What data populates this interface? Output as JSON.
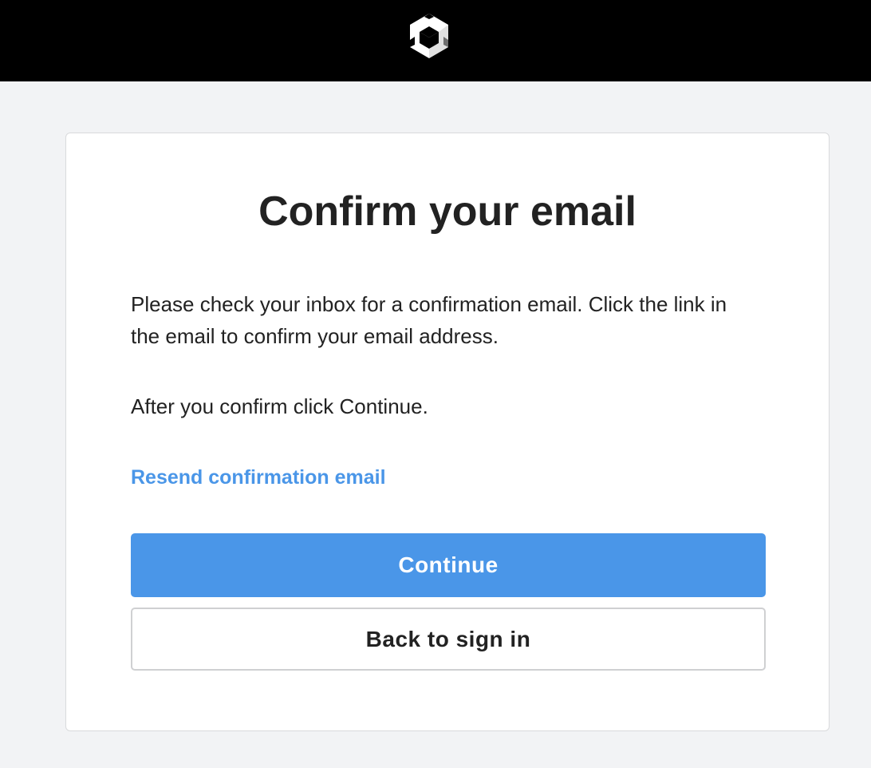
{
  "header": {
    "logo_icon": "unity-logo-icon"
  },
  "card": {
    "title": "Confirm your email",
    "message_1": "Please check your inbox for a confirmation email. Click the link in the email to confirm your email address.",
    "message_2": "After you confirm click Continue.",
    "resend_link": "Resend confirmation email",
    "continue_label": "Continue",
    "back_label": "Back to sign in"
  },
  "colors": {
    "accent": "#4a96e8",
    "header_bg": "#000000",
    "page_bg": "#f2f3f5",
    "text": "#222222"
  }
}
